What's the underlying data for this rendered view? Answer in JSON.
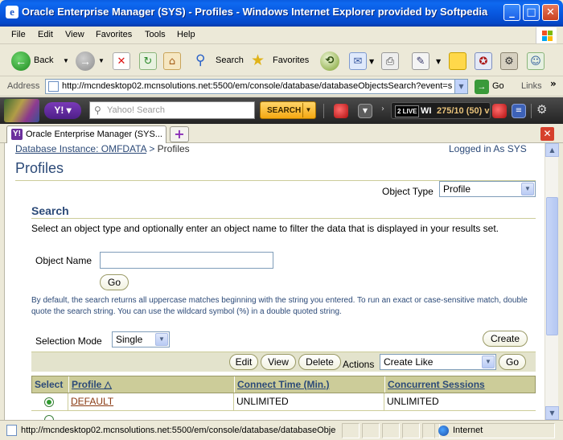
{
  "window": {
    "title": "Oracle Enterprise Manager (SYS) - Profiles - Windows Internet Explorer provided by Softpedia",
    "minimize": "_",
    "maximize": "□",
    "close": "✕"
  },
  "menu": [
    "File",
    "Edit",
    "View",
    "Favorites",
    "Tools",
    "Help"
  ],
  "toolbar": {
    "back": "Back",
    "search": "Search",
    "favorites": "Favorites"
  },
  "address": {
    "label": "Address",
    "url": "http://mcndesktop02.mcnsolutions.net:5500/em/console/database/databaseObjectsSearch?event=se",
    "go": "Go",
    "links": "Links"
  },
  "yahoo": {
    "logo": "Y!",
    "search_placeholder": "Yahoo! Search",
    "search_button": "SEARCH",
    "live_badge": "2 LIVE",
    "score_team": "WI",
    "score": "275/10 (50) v"
  },
  "tab": {
    "label": "Oracle Enterprise Manager (SYS...",
    "favicon": "Y!"
  },
  "page": {
    "breadcrumb_link": "Database Instance: OMFDATA",
    "breadcrumb_sep": ">",
    "breadcrumb_current": "Profiles",
    "logged_in": "Logged in As SYS",
    "title": "Profiles",
    "object_type_label": "Object Type",
    "object_type_value": "Profile",
    "search_heading": "Search",
    "search_description": "Select an object type and optionally enter an object name to filter the data that is displayed in your results set.",
    "object_name_label": "Object Name",
    "object_name_value": "",
    "go_button": "Go",
    "hint": "By default, the search returns all uppercase matches beginning with the string you entered. To run an exact or case-sensitive match, double quote the search string. You can use the wildcard symbol (%) in a double quoted string.",
    "selection_mode_label": "Selection Mode",
    "selection_mode_value": "Single",
    "create_button": "Create",
    "edit_button": "Edit",
    "view_button": "View",
    "delete_button": "Delete",
    "actions_label": "Actions",
    "actions_value": "Create Like",
    "actions_go": "Go"
  },
  "table": {
    "columns": [
      "Select",
      "Profile △",
      "Connect Time (Min.)",
      "Concurrent Sessions"
    ],
    "rows": [
      {
        "profile": "DEFAULT",
        "connect_time": "UNLIMITED",
        "sessions": "UNLIMITED",
        "selected": true
      }
    ]
  },
  "status": {
    "url": "http://mcndesktop02.mcnsolutions.net:5500/em/console/database/databaseObje",
    "zone": "Internet"
  }
}
